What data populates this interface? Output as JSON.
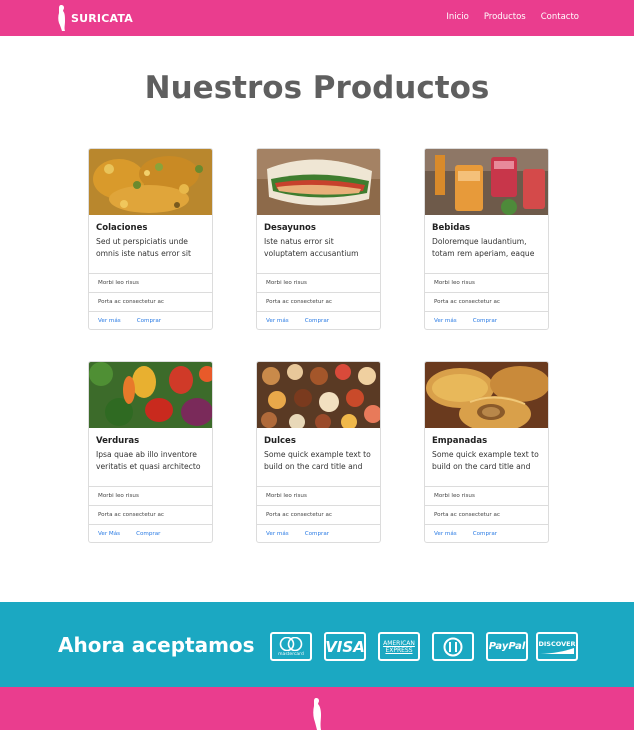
{
  "nav": {
    "brand": "SURICATA",
    "links": [
      "Inicio",
      "Productos",
      "Contacto"
    ]
  },
  "main": {
    "title": "Nuestros Productos",
    "cards": [
      {
        "title": "Colaciones",
        "text": "Sed ut perspiciatis unde omnis iste natus error sit",
        "items": [
          "Morbi leo risus",
          "Porta ac consectetur ac"
        ],
        "link1": "Ver más",
        "link2": "Comprar"
      },
      {
        "title": "Desayunos",
        "text": "Iste natus error sit voluptatem accusantium",
        "items": [
          "Morbi leo risus",
          "Porta ac consectetur ac"
        ],
        "link1": "Ver más",
        "link2": "Comprar"
      },
      {
        "title": "Bebidas",
        "text": "Doloremque laudantium, totam rem aperiam, eaque",
        "items": [
          "Morbi leo risus",
          "Porta ac consectetur ac"
        ],
        "link1": "Ver más",
        "link2": "Comprar"
      },
      {
        "title": "Verduras",
        "text": "Ipsa quae ab illo inventore veritatis et quasi architecto",
        "items": [
          "Morbi leo risus",
          "Porta ac consectetur ac"
        ],
        "link1": "Ver Más",
        "link2": "Comprar"
      },
      {
        "title": "Dulces",
        "text": "Some quick example text to build on the card title and",
        "items": [
          "Morbi leo risus",
          "Porta ac consectetur ac"
        ],
        "link1": "Ver más",
        "link2": "Comprar"
      },
      {
        "title": "Empanadas",
        "text": "Some quick example text to build on the card title and",
        "items": [
          "Morbi leo risus",
          "Porta ac consectetur ac"
        ],
        "link1": "Ver más",
        "link2": "Comprar"
      }
    ]
  },
  "payment": {
    "title": "Ahora aceptamos",
    "methods": {
      "mastercard": "mastercard",
      "visa": "VISA",
      "amex_line1": "AMERICAN",
      "amex_line2": "EXPRESS",
      "paypal": "PayPal",
      "discover": "DISCOVER"
    }
  },
  "colors": {
    "primary": "#ea3d8e",
    "band": "#1ba8c2",
    "link": "#2a7be4"
  }
}
